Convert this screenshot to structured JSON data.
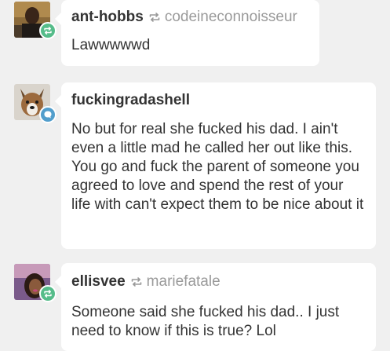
{
  "notes": [
    {
      "username": "ant-hobbs",
      "reblogged_from": "codeineconnoisseur",
      "type": "reblog",
      "text": "Lawwwwwd"
    },
    {
      "username": "fuckingradashell",
      "reblogged_from": "",
      "type": "reply",
      "text": "No but for real she fucked his dad. I ain't even a little mad he called her out like this. You go and fuck the parent of someone you agreed to love and spend the rest of your life with can't expect them to be nice about it"
    },
    {
      "username": "ellisvee",
      "reblogged_from": "mariefatale",
      "type": "reblog",
      "text": "Someone said she fucked his dad.. I just need to know if this is true? Lol"
    }
  ],
  "icons": {
    "reblog": "reblog-icon",
    "reply": "reply-icon"
  },
  "colors": {
    "reblog_badge": "#56bc8a",
    "reply_badge": "#529ecc",
    "background": "#f0f0f0",
    "card": "#ffffff"
  }
}
